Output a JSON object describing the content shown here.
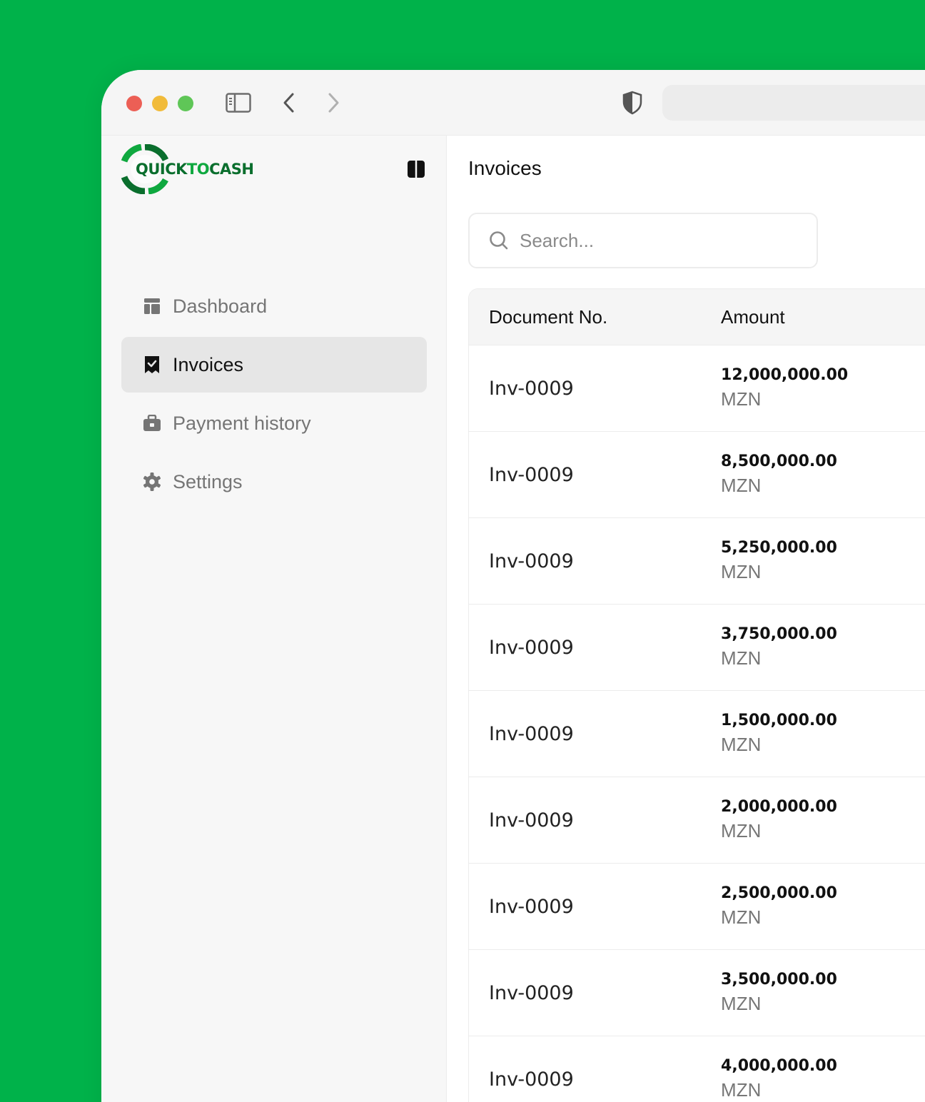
{
  "brand": {
    "quick": "QUICK",
    "to": "TO",
    "cash": "CASH"
  },
  "sidebar": {
    "items": [
      {
        "label": "Dashboard",
        "icon": "dashboard-icon",
        "active": false
      },
      {
        "label": "Invoices",
        "icon": "receipt-check-icon",
        "active": true
      },
      {
        "label": "Payment history",
        "icon": "briefcase-icon",
        "active": false
      },
      {
        "label": "Settings",
        "icon": "gear-icon",
        "active": false
      }
    ]
  },
  "main": {
    "title": "Invoices",
    "search": {
      "placeholder": "Search..."
    },
    "table": {
      "columns": [
        "Document No.",
        "Amount"
      ],
      "rows": [
        {
          "doc": "Inv-0009",
          "amount": "12,000,000.00",
          "currency": "MZN"
        },
        {
          "doc": "Inv-0009",
          "amount": "8,500,000.00",
          "currency": "MZN"
        },
        {
          "doc": "Inv-0009",
          "amount": "5,250,000.00",
          "currency": "MZN"
        },
        {
          "doc": "Inv-0009",
          "amount": "3,750,000.00",
          "currency": "MZN"
        },
        {
          "doc": "Inv-0009",
          "amount": "1,500,000.00",
          "currency": "MZN"
        },
        {
          "doc": "Inv-0009",
          "amount": "2,000,000.00",
          "currency": "MZN"
        },
        {
          "doc": "Inv-0009",
          "amount": "2,500,000.00",
          "currency": "MZN"
        },
        {
          "doc": "Inv-0009",
          "amount": "3,500,000.00",
          "currency": "MZN"
        },
        {
          "doc": "Inv-0009",
          "amount": "4,000,000.00",
          "currency": "MZN"
        }
      ]
    }
  },
  "colors": {
    "accent": "#00b24a",
    "brand_dark": "#0a6e2d",
    "active_bg": "#e6e6e6"
  }
}
